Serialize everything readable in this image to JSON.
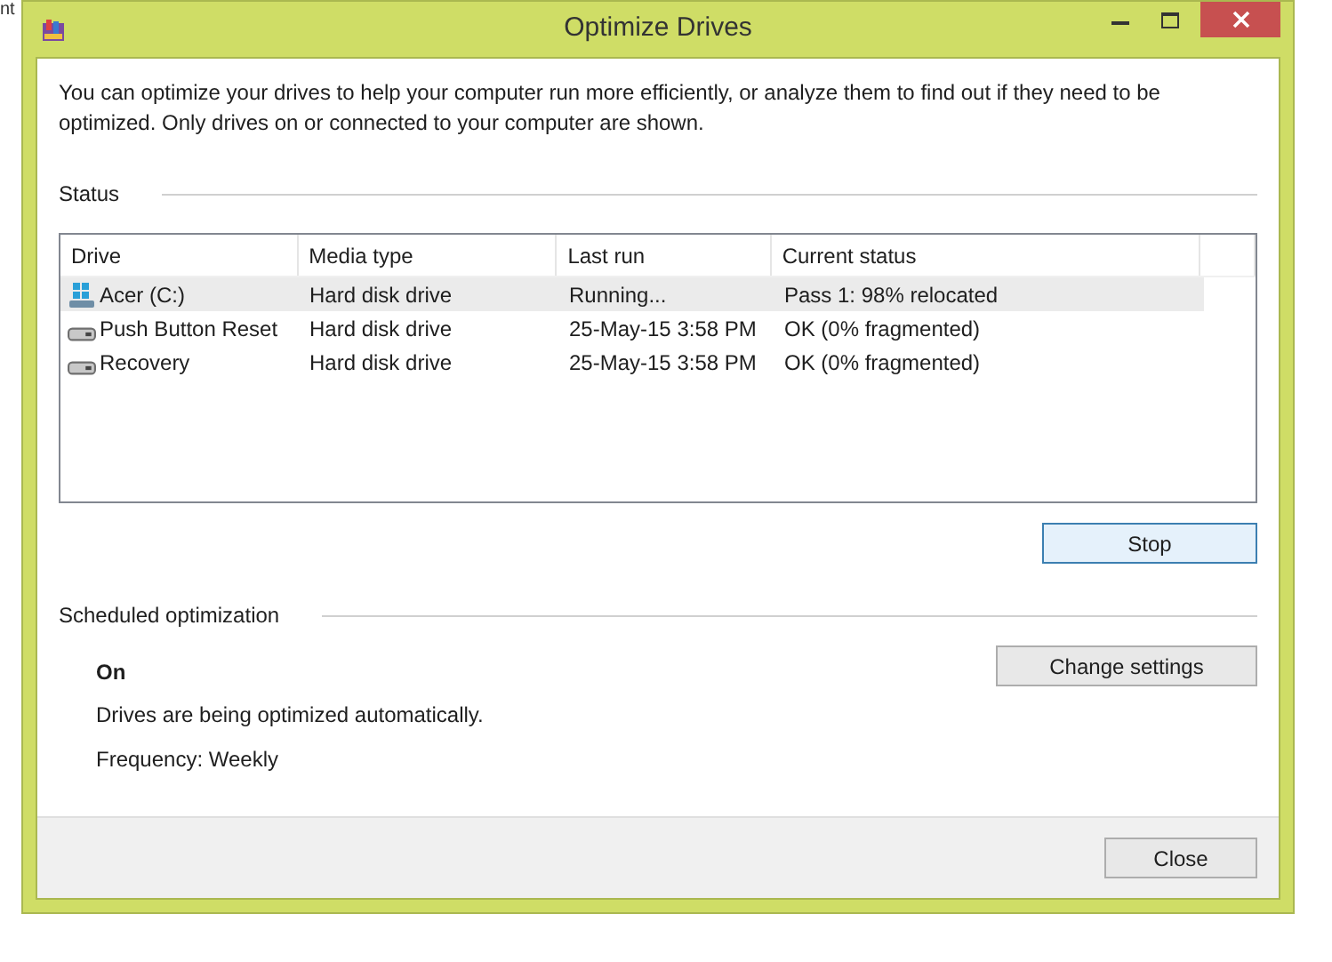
{
  "background_text": "nt",
  "window": {
    "title": "Optimize Drives"
  },
  "intro": "You can optimize your drives to help your computer run more efficiently, or analyze them to find out if they need to be optimized. Only drives on or connected to your computer are shown.",
  "status_heading": "Status",
  "table": {
    "columns": [
      "Drive",
      "Media type",
      "Last run",
      "Current status"
    ],
    "rows": [
      {
        "kind": "system",
        "selected": true,
        "cells": [
          "Acer (C:)",
          "Hard disk drive",
          "Running...",
          "Pass 1: 98% relocated"
        ]
      },
      {
        "kind": "disk",
        "selected": false,
        "cells": [
          "Push Button Reset",
          "Hard disk drive",
          "25-May-15 3:58 PM",
          "OK (0% fragmented)"
        ]
      },
      {
        "kind": "disk",
        "selected": false,
        "cells": [
          "Recovery",
          "Hard disk drive",
          "25-May-15 3:58 PM",
          "OK (0% fragmented)"
        ]
      }
    ]
  },
  "stop_button": "Stop",
  "scheduled": {
    "heading": "Scheduled optimization",
    "state": "On",
    "description": "Drives are being optimized automatically.",
    "frequency": "Frequency: Weekly",
    "button": "Change settings"
  },
  "close_button": "Close"
}
